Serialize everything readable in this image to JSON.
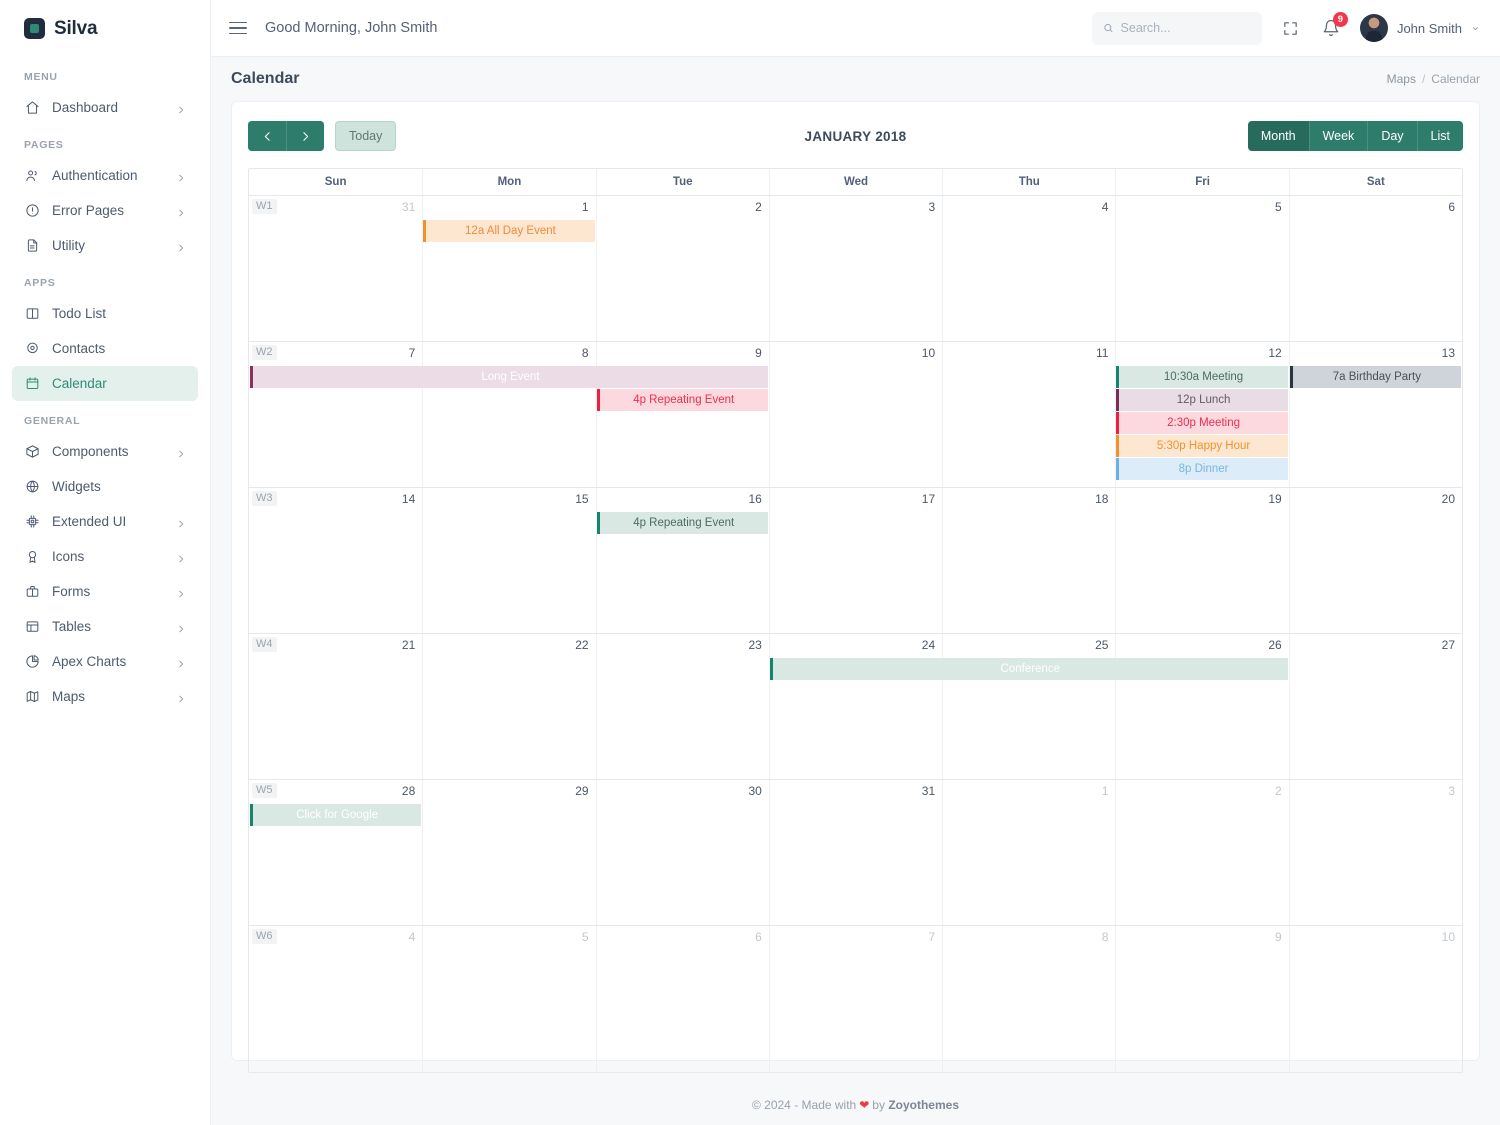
{
  "brand": {
    "name": "Silva"
  },
  "sidebar": {
    "sections": [
      {
        "label": "MENU",
        "items": [
          {
            "label": "Dashboard",
            "icon": "home-icon",
            "chevron": true,
            "active": false
          }
        ]
      },
      {
        "label": "PAGES",
        "items": [
          {
            "label": "Authentication",
            "icon": "users-icon",
            "chevron": true,
            "active": false
          },
          {
            "label": "Error Pages",
            "icon": "alert-circle-icon",
            "chevron": true,
            "active": false
          },
          {
            "label": "Utility",
            "icon": "file-text-icon",
            "chevron": true,
            "active": false
          }
        ]
      },
      {
        "label": "APPS",
        "items": [
          {
            "label": "Todo List",
            "icon": "columns-icon",
            "chevron": false,
            "active": false
          },
          {
            "label": "Contacts",
            "icon": "map-pin-icon",
            "chevron": false,
            "active": false
          },
          {
            "label": "Calendar",
            "icon": "calendar-icon",
            "chevron": false,
            "active": true
          }
        ]
      },
      {
        "label": "GENERAL",
        "items": [
          {
            "label": "Components",
            "icon": "box-icon",
            "chevron": true,
            "active": false
          },
          {
            "label": "Widgets",
            "icon": "globe-icon",
            "chevron": false,
            "active": false
          },
          {
            "label": "Extended UI",
            "icon": "cpu-icon",
            "chevron": true,
            "active": false
          },
          {
            "label": "Icons",
            "icon": "award-icon",
            "chevron": true,
            "active": false
          },
          {
            "label": "Forms",
            "icon": "briefcase-icon",
            "chevron": true,
            "active": false
          },
          {
            "label": "Tables",
            "icon": "table-icon",
            "chevron": true,
            "active": false
          },
          {
            "label": "Apex Charts",
            "icon": "pie-chart-icon",
            "chevron": true,
            "active": false
          },
          {
            "label": "Maps",
            "icon": "map-icon",
            "chevron": true,
            "active": false
          }
        ]
      }
    ]
  },
  "topbar": {
    "greeting": "Good Morning, John Smith",
    "search_placeholder": "Search...",
    "search_value": "",
    "notification_count": "9",
    "user_name": "John Smith"
  },
  "page": {
    "title": "Calendar",
    "breadcrumb": {
      "parent": "Maps",
      "separator": "/",
      "current": "Calendar"
    }
  },
  "calendar": {
    "title": "JANUARY 2018",
    "today_label": "Today",
    "views": [
      {
        "label": "Month",
        "active": true
      },
      {
        "label": "Week",
        "active": false
      },
      {
        "label": "Day",
        "active": false
      },
      {
        "label": "List",
        "active": false
      }
    ],
    "day_headers": [
      "Sun",
      "Mon",
      "Tue",
      "Wed",
      "Thu",
      "Fri",
      "Sat"
    ],
    "weeks": [
      {
        "week_label": "W1",
        "days": [
          {
            "num": "31",
            "muted": true
          },
          {
            "num": "1",
            "muted": false
          },
          {
            "num": "2",
            "muted": false
          },
          {
            "num": "3",
            "muted": false
          },
          {
            "num": "4",
            "muted": false
          },
          {
            "num": "5",
            "muted": false
          },
          {
            "num": "6",
            "muted": false
          }
        ],
        "events": [
          {
            "title": "12a All Day Event",
            "col": 2,
            "span": 1,
            "row": 1,
            "bg": "#fde7d0",
            "text": "#f08a3c",
            "accent": "#f0922e"
          }
        ]
      },
      {
        "week_label": "W2",
        "days": [
          {
            "num": "7",
            "muted": false
          },
          {
            "num": "8",
            "muted": false
          },
          {
            "num": "9",
            "muted": false
          },
          {
            "num": "10",
            "muted": false
          },
          {
            "num": "11",
            "muted": false
          },
          {
            "num": "12",
            "muted": false
          },
          {
            "num": "13",
            "muted": false
          }
        ],
        "events": [
          {
            "title": "Long Event",
            "col": 1,
            "span": 3,
            "row": 1,
            "bg": "#ecdce5",
            "text": "#ffffff",
            "accent": "#8c2f5c"
          },
          {
            "title": "4p Repeating Event",
            "col": 3,
            "span": 1,
            "row": 2,
            "bg": "#fbd9de",
            "text": "#ef2e4e",
            "accent": "#ef1f42"
          },
          {
            "title": "10:30a Meeting",
            "col": 6,
            "span": 1,
            "row": 1,
            "bg": "#d9e8e3",
            "text": "#4d6b64",
            "accent": "#17856e"
          },
          {
            "title": "12p Lunch",
            "col": 6,
            "span": 1,
            "row": 2,
            "bg": "#e8dde5",
            "text": "#6e5566",
            "accent": "#7b2d55"
          },
          {
            "title": "2:30p Meeting",
            "col": 6,
            "span": 1,
            "row": 3,
            "bg": "#fbd9de",
            "text": "#ef2e4e",
            "accent": "#f01f3f"
          },
          {
            "title": "5:30p Happy Hour",
            "col": 6,
            "span": 1,
            "row": 4,
            "bg": "#fde7d0",
            "text": "#f0922e",
            "accent": "#f0922e"
          },
          {
            "title": "8p Dinner",
            "col": 6,
            "span": 1,
            "row": 5,
            "bg": "#dcecf8",
            "text": "#7cb5e0",
            "accent": "#69b2e3"
          },
          {
            "title": "7a Birthday Party",
            "col": 7,
            "span": 1,
            "row": 1,
            "bg": "#cfd4da",
            "text": "#48505c",
            "accent": "#2c3542"
          }
        ]
      },
      {
        "week_label": "W3",
        "days": [
          {
            "num": "14",
            "muted": false
          },
          {
            "num": "15",
            "muted": false
          },
          {
            "num": "16",
            "muted": false
          },
          {
            "num": "17",
            "muted": false
          },
          {
            "num": "18",
            "muted": false
          },
          {
            "num": "19",
            "muted": false
          },
          {
            "num": "20",
            "muted": false
          }
        ],
        "events": [
          {
            "title": "4p Repeating Event",
            "col": 3,
            "span": 1,
            "row": 1,
            "bg": "#d9e8e3",
            "text": "#4d6b64",
            "accent": "#17856e"
          }
        ]
      },
      {
        "week_label": "W4",
        "days": [
          {
            "num": "21",
            "muted": false
          },
          {
            "num": "22",
            "muted": false
          },
          {
            "num": "23",
            "muted": false
          },
          {
            "num": "24",
            "muted": false
          },
          {
            "num": "25",
            "muted": false
          },
          {
            "num": "26",
            "muted": false
          },
          {
            "num": "27",
            "muted": false
          }
        ],
        "events": [
          {
            "title": "Conference",
            "col": 4,
            "span": 3,
            "row": 1,
            "bg": "#d9e8e3",
            "text": "#ffffff",
            "accent": "#17856e"
          }
        ]
      },
      {
        "week_label": "W5",
        "days": [
          {
            "num": "28",
            "muted": false
          },
          {
            "num": "29",
            "muted": false
          },
          {
            "num": "30",
            "muted": false
          },
          {
            "num": "31",
            "muted": false
          },
          {
            "num": "1",
            "muted": true
          },
          {
            "num": "2",
            "muted": true
          },
          {
            "num": "3",
            "muted": true
          }
        ],
        "events": [
          {
            "title": "Click for Google",
            "col": 1,
            "span": 1,
            "row": 1,
            "bg": "#d9e8e3",
            "text": "#ffffff",
            "accent": "#17856e"
          }
        ]
      },
      {
        "week_label": "W6",
        "days": [
          {
            "num": "4",
            "muted": true
          },
          {
            "num": "5",
            "muted": true
          },
          {
            "num": "6",
            "muted": true
          },
          {
            "num": "7",
            "muted": true
          },
          {
            "num": "8",
            "muted": true
          },
          {
            "num": "9",
            "muted": true
          },
          {
            "num": "10",
            "muted": true
          }
        ],
        "events": []
      }
    ]
  },
  "footer": {
    "copyright": "© 2024 - Made with",
    "by": "by",
    "author": "Zoyothemes"
  },
  "colors": {
    "accent": "#2e7d6c",
    "active_nav_bg": "#e3f0ec",
    "badge": "#f1374a"
  }
}
